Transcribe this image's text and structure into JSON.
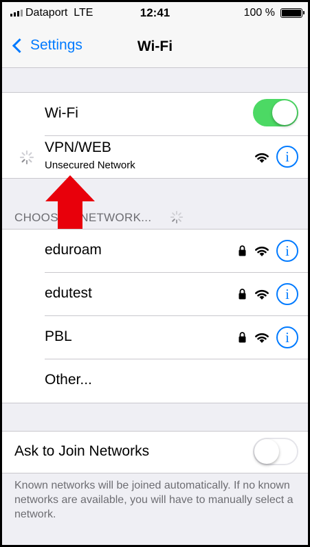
{
  "status_bar": {
    "carrier": "Dataport",
    "network": "LTE",
    "time": "12:41",
    "battery": "100 %",
    "battery_level": 1.0
  },
  "nav": {
    "back_label": "Settings",
    "title": "Wi-Fi"
  },
  "wifi_toggle": {
    "label": "Wi-Fi",
    "state": "on",
    "color": "#4cd964"
  },
  "connected": {
    "name": "VPN/WEB",
    "subtitle": "Unsecured Network",
    "icons": [
      "spinner-icon",
      "wifi-icon",
      "info-icon"
    ]
  },
  "choose_header": "CHOOSE A NETWORK...",
  "networks": [
    {
      "name": "eduroam",
      "secured": true
    },
    {
      "name": "edutest",
      "secured": true
    },
    {
      "name": "PBL",
      "secured": true
    },
    {
      "name": "Other..."
    }
  ],
  "info_glyph": "i",
  "ask_to_join": {
    "label": "Ask to Join Networks",
    "state": "off"
  },
  "footer_text": "Known networks will be joined automatically. If no known networks are available, you will have to manually select a network.",
  "colors": {
    "accent": "#007aff",
    "annotation_arrow": "#e8000b",
    "background": "#efeff4"
  }
}
